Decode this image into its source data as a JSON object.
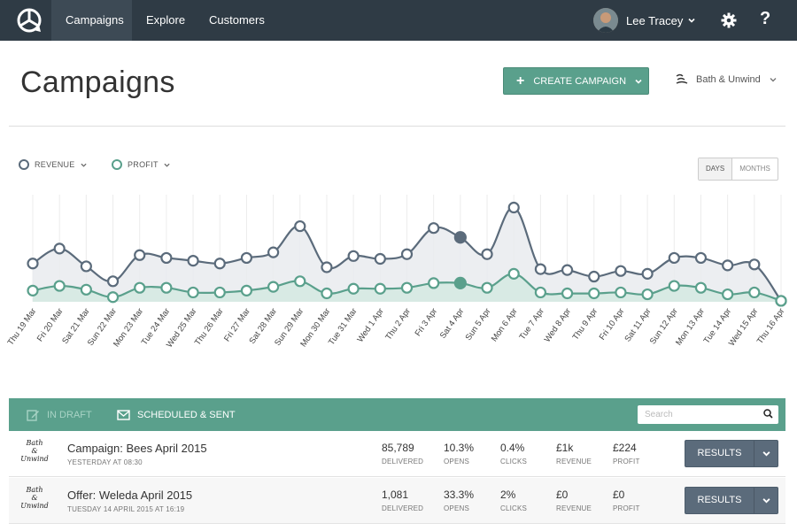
{
  "nav": {
    "tabs": [
      "Campaigns",
      "Explore",
      "Customers"
    ],
    "user_name": "Lee Tracey",
    "help_label": "?"
  },
  "header": {
    "title": "Campaigns",
    "create_label": "CREATE CAMPAIGN",
    "brand_label": "Bath & Unwind"
  },
  "legend": {
    "revenue_label": "REVENUE",
    "profit_label": "PROFIT",
    "revenue_color": "#5b6b7b",
    "profit_color": "#5aa08c"
  },
  "toggle": {
    "days": "DAYS",
    "months": "MONTHS"
  },
  "chart_data": {
    "type": "area",
    "x": [
      "Thu 19 Mar",
      "Fri 20 Mar",
      "Sat 21 Mar",
      "Sun 22 Mar",
      "Mon 23 Mar",
      "Tue 24 Mar",
      "Wed 25 Mar",
      "Thu 26 Mar",
      "Fri 27 Mar",
      "Sat 28 Mar",
      "Sun 29 Mar",
      "Mon 30 Mar",
      "Tue 31 Mar",
      "Wed 1 Apr",
      "Thu 2 Apr",
      "Fri 3 Apr",
      "Sat 4 Apr",
      "Sun 5 Apr",
      "Mon 6 Apr",
      "Tue 7 Apr",
      "Wed 8 Apr",
      "Thu 9 Apr",
      "Fri 10 Apr",
      "Sat 11 Apr",
      "Sun 12 Apr",
      "Mon 13 Apr",
      "Tue 14 Apr",
      "Wed 15 Apr",
      "Thu 16 Apr"
    ],
    "series": [
      {
        "name": "REVENUE",
        "color": "#5b6b7b",
        "values": [
          41,
          57,
          38,
          22,
          50,
          47,
          44,
          41,
          47,
          53,
          81,
          37,
          49,
          46,
          51,
          79,
          69,
          51,
          101,
          35,
          34,
          27,
          33,
          30,
          47,
          47,
          39,
          40,
          1
        ]
      },
      {
        "name": "PROFIT",
        "color": "#5aa08c",
        "values": [
          12,
          17,
          13,
          5,
          15,
          15,
          10,
          10,
          12,
          16,
          22,
          9,
          14,
          14,
          15,
          20,
          20,
          15,
          30,
          10,
          9,
          9,
          10,
          8,
          17,
          15,
          8,
          10,
          1
        ]
      }
    ],
    "highlight_index": 16,
    "ylim": [
      0,
      110
    ],
    "grid": "vertical"
  },
  "tabs": {
    "draft_label": "IN DRAFT",
    "sent_label": "SCHEDULED & SENT",
    "search_placeholder": "Search"
  },
  "rows": [
    {
      "logo_text": "Bath & Unwind",
      "name": "Campaign: Bees April 2015",
      "date": "YESTERDAY AT 08:30",
      "delivered": "85,789",
      "opens": "10.3%",
      "clicks": "0.4%",
      "revenue": "£1k",
      "profit": "£224",
      "action": "RESULTS"
    },
    {
      "logo_text": "Bath & Unwind",
      "name": "Offer: Weleda April 2015",
      "date": "TUESDAY 14 APRIL 2015 AT 16:19",
      "delivered": "1,081",
      "opens": "33.3%",
      "clicks": "2%",
      "revenue": "£0",
      "profit": "£0",
      "action": "RESULTS"
    }
  ],
  "stat_labels": {
    "delivered": "DELIVERED",
    "opens": "OPENS",
    "clicks": "CLICKS",
    "revenue": "REVENUE",
    "profit": "PROFIT"
  }
}
